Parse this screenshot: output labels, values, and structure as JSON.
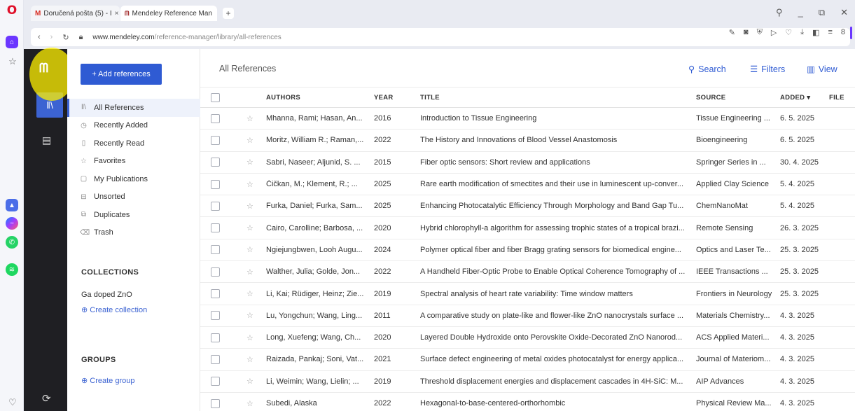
{
  "browser": {
    "tabs": [
      {
        "label": "Doručená pošta (5) - I",
        "icon": "gmail-icon"
      },
      {
        "label": "Mendeley Reference Man",
        "icon": "mendeley-icon"
      }
    ],
    "new_tab": "+",
    "url_domain": "www.mendeley.com",
    "url_path": "/reference-manager/library/all-references"
  },
  "sidebar": {
    "add_button": "+ Add references",
    "nav": [
      {
        "label": "All References",
        "icon": "library-icon",
        "active": true
      },
      {
        "label": "Recently Added",
        "icon": "clock-icon"
      },
      {
        "label": "Recently Read",
        "icon": "bookmark-icon"
      },
      {
        "label": "Favorites",
        "icon": "star-icon"
      },
      {
        "label": "My Publications",
        "icon": "publication-icon"
      },
      {
        "label": "Unsorted",
        "icon": "inbox-icon"
      },
      {
        "label": "Duplicates",
        "icon": "duplicate-icon"
      },
      {
        "label": "Trash",
        "icon": "trash-icon"
      }
    ],
    "collections_heading": "COLLECTIONS",
    "collections": [
      "Ga doped ZnO"
    ],
    "create_collection": "⊕ Create collection",
    "groups_heading": "GROUPS",
    "create_group": "⊕ Create group"
  },
  "main": {
    "title": "All References",
    "search_label": "Search",
    "filters_label": "Filters",
    "view_label": "View",
    "columns": {
      "authors": "AUTHORS",
      "year": "YEAR",
      "title": "TITLE",
      "source": "SOURCE",
      "added": "ADDED ▾",
      "file": "FILE"
    },
    "rows": [
      {
        "authors": "Mhanna, Rami; Hasan, An...",
        "year": "2016",
        "title": "Introduction to Tissue Engineering",
        "source": "Tissue Engineering ...",
        "added": "6. 5. 2025"
      },
      {
        "authors": "Moritz, William R.; Raman,...",
        "year": "2022",
        "title": "The History and Innovations of Blood Vessel Anastomosis",
        "source": "Bioengineering",
        "added": "6. 5. 2025"
      },
      {
        "authors": "Sabri, Naseer; Aljunid, S. ...",
        "year": "2015",
        "title": "Fiber optic sensors: Short review and applications",
        "source": "Springer Series in ...",
        "added": "30. 4. 2025"
      },
      {
        "authors": "Čičkan, M.; Klement, R.; ...",
        "year": "2025",
        "title": "Rare earth modification of smectites and their use in luminescent up-conver...",
        "source": "Applied Clay Science",
        "added": "5. 4. 2025"
      },
      {
        "authors": "Furka, Daniel; Furka, Sam...",
        "year": "2025",
        "title": "Enhancing Photocatalytic Efficiency Through Morphology and Band Gap Tu...",
        "source": "ChemNanoMat",
        "added": "5. 4. 2025"
      },
      {
        "authors": "Cairo, Carolline; Barbosa, ...",
        "year": "2020",
        "title": "Hybrid chlorophyll-a algorithm for assessing trophic states of a tropical brazi...",
        "source": "Remote Sensing",
        "added": "26. 3. 2025"
      },
      {
        "authors": "Ngiejungbwen, Looh Augu...",
        "year": "2024",
        "title": "Polymer optical fiber and fiber Bragg grating sensors for biomedical engine...",
        "source": "Optics and Laser Te...",
        "added": "25. 3. 2025"
      },
      {
        "authors": "Walther, Julia; Golde, Jon...",
        "year": "2022",
        "title": "A Handheld Fiber-Optic Probe to Enable Optical Coherence Tomography of ...",
        "source": "IEEE Transactions ...",
        "added": "25. 3. 2025"
      },
      {
        "authors": "Li, Kai; Rüdiger, Heinz; Zie...",
        "year": "2019",
        "title": "Spectral analysis of heart rate variability: Time window matters",
        "source": "Frontiers in Neurology",
        "added": "25. 3. 2025"
      },
      {
        "authors": "Lu, Yongchun; Wang, Ling...",
        "year": "2011",
        "title": "A comparative study on plate-like and flower-like ZnO nanocrystals surface ...",
        "source": "Materials Chemistry...",
        "added": "4. 3. 2025"
      },
      {
        "authors": "Long, Xuefeng; Wang, Ch...",
        "year": "2020",
        "title": "Layered Double Hydroxide onto Perovskite Oxide-Decorated ZnO Nanorod...",
        "source": "ACS Applied Materi...",
        "added": "4. 3. 2025"
      },
      {
        "authors": "Raizada, Pankaj; Soni, Vat...",
        "year": "2021",
        "title": "Surface defect engineering of metal oxides photocatalyst for energy applica...",
        "source": "Journal of Materiom...",
        "added": "4. 3. 2025"
      },
      {
        "authors": "Li, Weimin; Wang, Lielin; ...",
        "year": "2019",
        "title": "Threshold displacement energies and displacement cascades in 4H-SiC: M...",
        "source": "AIP Advances",
        "added": "4. 3. 2025"
      },
      {
        "authors": "Subedi, Alaska",
        "year": "2022",
        "title": "Hexagonal-to-base-centered-orthorhombic",
        "source": "Physical Review Ma...",
        "added": "4. 3. 2025"
      }
    ]
  },
  "colors": {
    "accent": "#2f5bd3",
    "mendeley_rail": "#1f1f23",
    "highlight": "#fff000"
  }
}
